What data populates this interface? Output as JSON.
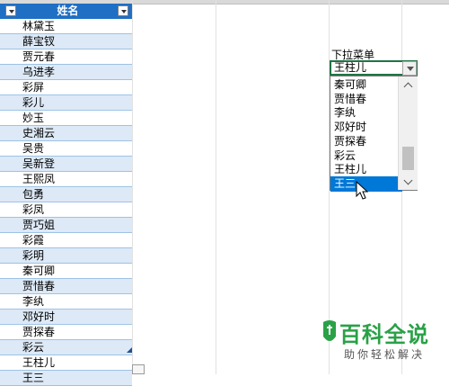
{
  "table": {
    "header": "姓名",
    "rows": [
      "林黛玉",
      "薛宝钗",
      "贾元春",
      "乌进孝",
      "彩屏",
      "彩儿",
      "妙玉",
      "史湘云",
      "吴贵",
      "吴新登",
      "王熙凤",
      "包勇",
      "彩凤",
      "贾巧姐",
      "彩霞",
      "彩明",
      "秦可卿",
      "贾惜春",
      "李纨",
      "邓好时",
      "贾探春",
      "彩云",
      "王柱儿",
      "王三"
    ]
  },
  "dropdown": {
    "label": "下拉菜单",
    "value": "王柱儿",
    "options": [
      "秦可卿",
      "贾惜春",
      "李纨",
      "邓好时",
      "贾探春",
      "彩云",
      "王柱儿",
      "王三"
    ],
    "selected": "王三"
  },
  "watermark": {
    "main": "百科全说",
    "sub": "助你轻松解决"
  },
  "colors": {
    "header": "#1f6fc4",
    "band": "#dde9f6",
    "selection": "#0078d7",
    "active_border": "#217346",
    "watermark": "#2aa147"
  },
  "icons": [
    "dropdown-arrow-icon",
    "chevron-up-icon",
    "chevron-down-icon",
    "mouse-cursor-icon",
    "table-resize-icon",
    "paste-options-icon"
  ]
}
